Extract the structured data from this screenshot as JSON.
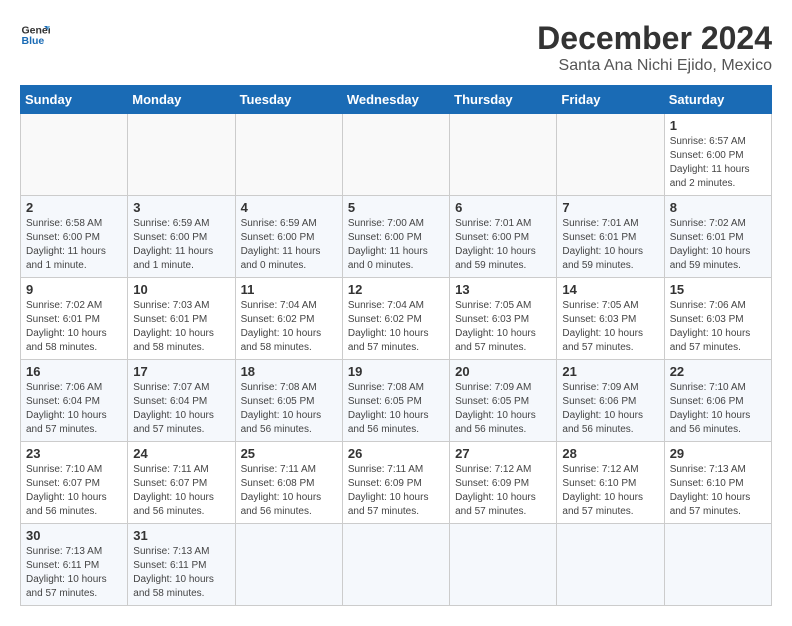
{
  "logo": {
    "line1": "General",
    "line2": "Blue"
  },
  "title": "December 2024",
  "location": "Santa Ana Nichi Ejido, Mexico",
  "weekdays": [
    "Sunday",
    "Monday",
    "Tuesday",
    "Wednesday",
    "Thursday",
    "Friday",
    "Saturday"
  ],
  "days": [
    {
      "num": "",
      "sunrise": "",
      "sunset": "",
      "daylight": ""
    },
    {
      "num": "",
      "sunrise": "",
      "sunset": "",
      "daylight": ""
    },
    {
      "num": "",
      "sunrise": "",
      "sunset": "",
      "daylight": ""
    },
    {
      "num": "",
      "sunrise": "",
      "sunset": "",
      "daylight": ""
    },
    {
      "num": "",
      "sunrise": "",
      "sunset": "",
      "daylight": ""
    },
    {
      "num": "",
      "sunrise": "",
      "sunset": "",
      "daylight": ""
    },
    {
      "num": "1",
      "sunrise": "Sunrise: 6:57 AM",
      "sunset": "Sunset: 6:00 PM",
      "daylight": "Daylight: 11 hours and 2 minutes."
    },
    {
      "num": "2",
      "sunrise": "Sunrise: 6:58 AM",
      "sunset": "Sunset: 6:00 PM",
      "daylight": "Daylight: 11 hours and 1 minute."
    },
    {
      "num": "3",
      "sunrise": "Sunrise: 6:59 AM",
      "sunset": "Sunset: 6:00 PM",
      "daylight": "Daylight: 11 hours and 1 minute."
    },
    {
      "num": "4",
      "sunrise": "Sunrise: 6:59 AM",
      "sunset": "Sunset: 6:00 PM",
      "daylight": "Daylight: 11 hours and 0 minutes."
    },
    {
      "num": "5",
      "sunrise": "Sunrise: 7:00 AM",
      "sunset": "Sunset: 6:00 PM",
      "daylight": "Daylight: 11 hours and 0 minutes."
    },
    {
      "num": "6",
      "sunrise": "Sunrise: 7:01 AM",
      "sunset": "Sunset: 6:00 PM",
      "daylight": "Daylight: 10 hours and 59 minutes."
    },
    {
      "num": "7",
      "sunrise": "Sunrise: 7:01 AM",
      "sunset": "Sunset: 6:01 PM",
      "daylight": "Daylight: 10 hours and 59 minutes."
    },
    {
      "num": "8",
      "sunrise": "Sunrise: 7:02 AM",
      "sunset": "Sunset: 6:01 PM",
      "daylight": "Daylight: 10 hours and 59 minutes."
    },
    {
      "num": "9",
      "sunrise": "Sunrise: 7:02 AM",
      "sunset": "Sunset: 6:01 PM",
      "daylight": "Daylight: 10 hours and 58 minutes."
    },
    {
      "num": "10",
      "sunrise": "Sunrise: 7:03 AM",
      "sunset": "Sunset: 6:01 PM",
      "daylight": "Daylight: 10 hours and 58 minutes."
    },
    {
      "num": "11",
      "sunrise": "Sunrise: 7:04 AM",
      "sunset": "Sunset: 6:02 PM",
      "daylight": "Daylight: 10 hours and 58 minutes."
    },
    {
      "num": "12",
      "sunrise": "Sunrise: 7:04 AM",
      "sunset": "Sunset: 6:02 PM",
      "daylight": "Daylight: 10 hours and 57 minutes."
    },
    {
      "num": "13",
      "sunrise": "Sunrise: 7:05 AM",
      "sunset": "Sunset: 6:03 PM",
      "daylight": "Daylight: 10 hours and 57 minutes."
    },
    {
      "num": "14",
      "sunrise": "Sunrise: 7:05 AM",
      "sunset": "Sunset: 6:03 PM",
      "daylight": "Daylight: 10 hours and 57 minutes."
    },
    {
      "num": "15",
      "sunrise": "Sunrise: 7:06 AM",
      "sunset": "Sunset: 6:03 PM",
      "daylight": "Daylight: 10 hours and 57 minutes."
    },
    {
      "num": "16",
      "sunrise": "Sunrise: 7:06 AM",
      "sunset": "Sunset: 6:04 PM",
      "daylight": "Daylight: 10 hours and 57 minutes."
    },
    {
      "num": "17",
      "sunrise": "Sunrise: 7:07 AM",
      "sunset": "Sunset: 6:04 PM",
      "daylight": "Daylight: 10 hours and 57 minutes."
    },
    {
      "num": "18",
      "sunrise": "Sunrise: 7:08 AM",
      "sunset": "Sunset: 6:05 PM",
      "daylight": "Daylight: 10 hours and 56 minutes."
    },
    {
      "num": "19",
      "sunrise": "Sunrise: 7:08 AM",
      "sunset": "Sunset: 6:05 PM",
      "daylight": "Daylight: 10 hours and 56 minutes."
    },
    {
      "num": "20",
      "sunrise": "Sunrise: 7:09 AM",
      "sunset": "Sunset: 6:05 PM",
      "daylight": "Daylight: 10 hours and 56 minutes."
    },
    {
      "num": "21",
      "sunrise": "Sunrise: 7:09 AM",
      "sunset": "Sunset: 6:06 PM",
      "daylight": "Daylight: 10 hours and 56 minutes."
    },
    {
      "num": "22",
      "sunrise": "Sunrise: 7:10 AM",
      "sunset": "Sunset: 6:06 PM",
      "daylight": "Daylight: 10 hours and 56 minutes."
    },
    {
      "num": "23",
      "sunrise": "Sunrise: 7:10 AM",
      "sunset": "Sunset: 6:07 PM",
      "daylight": "Daylight: 10 hours and 56 minutes."
    },
    {
      "num": "24",
      "sunrise": "Sunrise: 7:11 AM",
      "sunset": "Sunset: 6:07 PM",
      "daylight": "Daylight: 10 hours and 56 minutes."
    },
    {
      "num": "25",
      "sunrise": "Sunrise: 7:11 AM",
      "sunset": "Sunset: 6:08 PM",
      "daylight": "Daylight: 10 hours and 56 minutes."
    },
    {
      "num": "26",
      "sunrise": "Sunrise: 7:11 AM",
      "sunset": "Sunset: 6:09 PM",
      "daylight": "Daylight: 10 hours and 57 minutes."
    },
    {
      "num": "27",
      "sunrise": "Sunrise: 7:12 AM",
      "sunset": "Sunset: 6:09 PM",
      "daylight": "Daylight: 10 hours and 57 minutes."
    },
    {
      "num": "28",
      "sunrise": "Sunrise: 7:12 AM",
      "sunset": "Sunset: 6:10 PM",
      "daylight": "Daylight: 10 hours and 57 minutes."
    },
    {
      "num": "29",
      "sunrise": "Sunrise: 7:13 AM",
      "sunset": "Sunset: 6:10 PM",
      "daylight": "Daylight: 10 hours and 57 minutes."
    },
    {
      "num": "30",
      "sunrise": "Sunrise: 7:13 AM",
      "sunset": "Sunset: 6:11 PM",
      "daylight": "Daylight: 10 hours and 57 minutes."
    },
    {
      "num": "31",
      "sunrise": "Sunrise: 7:13 AM",
      "sunset": "Sunset: 6:11 PM",
      "daylight": "Daylight: 10 hours and 58 minutes."
    },
    {
      "num": "",
      "sunrise": "",
      "sunset": "",
      "daylight": ""
    },
    {
      "num": "",
      "sunrise": "",
      "sunset": "",
      "daylight": ""
    },
    {
      "num": "",
      "sunrise": "",
      "sunset": "",
      "daylight": ""
    },
    {
      "num": "",
      "sunrise": "",
      "sunset": "",
      "daylight": ""
    },
    {
      "num": "",
      "sunrise": "",
      "sunset": "",
      "daylight": ""
    }
  ]
}
